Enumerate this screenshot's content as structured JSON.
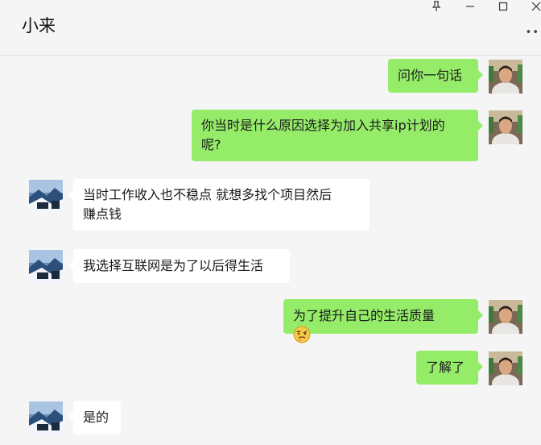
{
  "window": {
    "title": "小来",
    "pin_icon": "pin-icon",
    "minimize_icon": "minimize-icon",
    "maximize_icon": "maximize-icon",
    "close_icon": "close-icon",
    "more_icon": "more-dots-icon"
  },
  "colors": {
    "my_bubble": "#95ec69",
    "other_bubble": "#ffffff",
    "background": "#f5f5f5"
  },
  "messages": [
    {
      "sender": "me",
      "lines": [
        "问你一句话"
      ]
    },
    {
      "sender": "me",
      "lines": [
        "你当时是什么原因选择为加入共享ip计划的",
        "呢?"
      ]
    },
    {
      "sender": "other",
      "lines": [
        "当时工作收入也不稳点  就想多找个项目然后",
        "赚点钱"
      ]
    },
    {
      "sender": "other",
      "lines": [
        "我选择互联网是为了以后得生活"
      ]
    },
    {
      "sender": "me",
      "lines": [
        "为了提升自己的生活质量"
      ],
      "emoji": "thinking-face-emoji"
    },
    {
      "sender": "me",
      "lines": [
        "了解了"
      ]
    },
    {
      "sender": "other",
      "lines": [
        "是的"
      ]
    }
  ]
}
